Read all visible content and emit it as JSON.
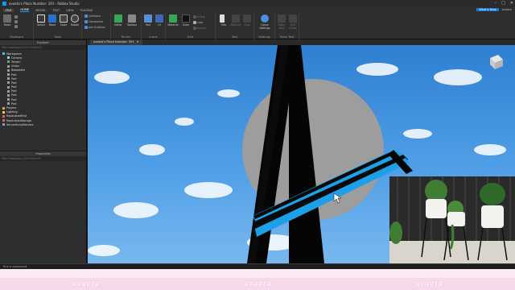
{
  "window": {
    "title": "avaeta's Place Number: 391 - Roblox Studio",
    "controls": [
      "–",
      "□",
      "✕"
    ]
  },
  "menu": {
    "file": "FILE",
    "tabs": [
      "HOME",
      "MODEL",
      "TEST",
      "VIEW",
      "PLUGINS"
    ],
    "active": "HOME",
    "whats_new": "What's New",
    "user": "avaeta"
  },
  "ribbon": {
    "groups": {
      "clipboard": "Clipboard",
      "tools": "Tools",
      "terrain": "Terrain",
      "insert": "Insert",
      "edit": "Edit",
      "test": "Test",
      "settings": "Settings",
      "team_test": "Team Test"
    },
    "tools": {
      "paste": "Paste",
      "select": "Select",
      "move": "Move",
      "scale": "Scale",
      "rotate": "Rotate",
      "editor": "Editor",
      "toolbox": "Toolbox",
      "part": "Part",
      "ui": "UI",
      "material": "Material",
      "color": "Color",
      "play": "Play",
      "game_settings": "Game Settings",
      "team_create": "Team Test",
      "exit_game": "Exit Game",
      "resume": "Resume",
      "stop": "Stop"
    },
    "toggles": {
      "collisions": "Collisions",
      "constraints": "Constraints",
      "join_surfaces": "Join Surfaces",
      "group": "Group",
      "lock": "Lock",
      "anchor": "Anchor"
    },
    "colors": {
      "material_green": "#3aa655",
      "color_black": "#111111",
      "accent": "#00a2ff"
    }
  },
  "explorer": {
    "title": "Explorer",
    "filter_placeholder": "Filter workspace (Ctrl+Shift+X)",
    "items": [
      {
        "label": "Workspace",
        "indent": 0,
        "icon": "#4fc0ff"
      },
      {
        "label": "Camera",
        "indent": 1,
        "icon": "#9ad0ff"
      },
      {
        "label": "Terrain",
        "indent": 1,
        "icon": "#5cb85c"
      },
      {
        "label": "Union",
        "indent": 1,
        "icon": "#9aa0a6"
      },
      {
        "label": "Baseplate",
        "indent": 1,
        "icon": "#9aa0a6"
      },
      {
        "label": "Part",
        "indent": 1,
        "icon": "#9aa0a6"
      },
      {
        "label": "Part",
        "indent": 1,
        "icon": "#9aa0a6"
      },
      {
        "label": "Part",
        "indent": 1,
        "icon": "#9aa0a6"
      },
      {
        "label": "Part",
        "indent": 1,
        "icon": "#9aa0a6"
      },
      {
        "label": "Part",
        "indent": 1,
        "icon": "#9aa0a6"
      },
      {
        "label": "Part",
        "indent": 1,
        "icon": "#9aa0a6"
      },
      {
        "label": "Part",
        "indent": 1,
        "icon": "#9aa0a6"
      },
      {
        "label": "Part",
        "indent": 1,
        "icon": "#9aa0a6"
      },
      {
        "label": "Players",
        "indent": 0,
        "icon": "#f0a040"
      },
      {
        "label": "Lighting",
        "indent": 0,
        "icon": "#f5d142"
      },
      {
        "label": "ReplicatedFirst",
        "indent": 0,
        "icon": "#e06060"
      },
      {
        "label": "ReplicatedStorage",
        "indent": 0,
        "icon": "#e06060"
      },
      {
        "label": "ServerScriptService",
        "indent": 0,
        "icon": "#7aa0e0"
      }
    ]
  },
  "properties": {
    "title": "Properties",
    "filter_placeholder": "Filter Properties (Ctrl+Shift+P)"
  },
  "document_tab": {
    "label": "avaeta's Place Number: 391",
    "close": "✕"
  },
  "command_bar": {
    "placeholder": "Run a command"
  },
  "branding": [
    "avaeta",
    "avaeta",
    "avaeta"
  ]
}
